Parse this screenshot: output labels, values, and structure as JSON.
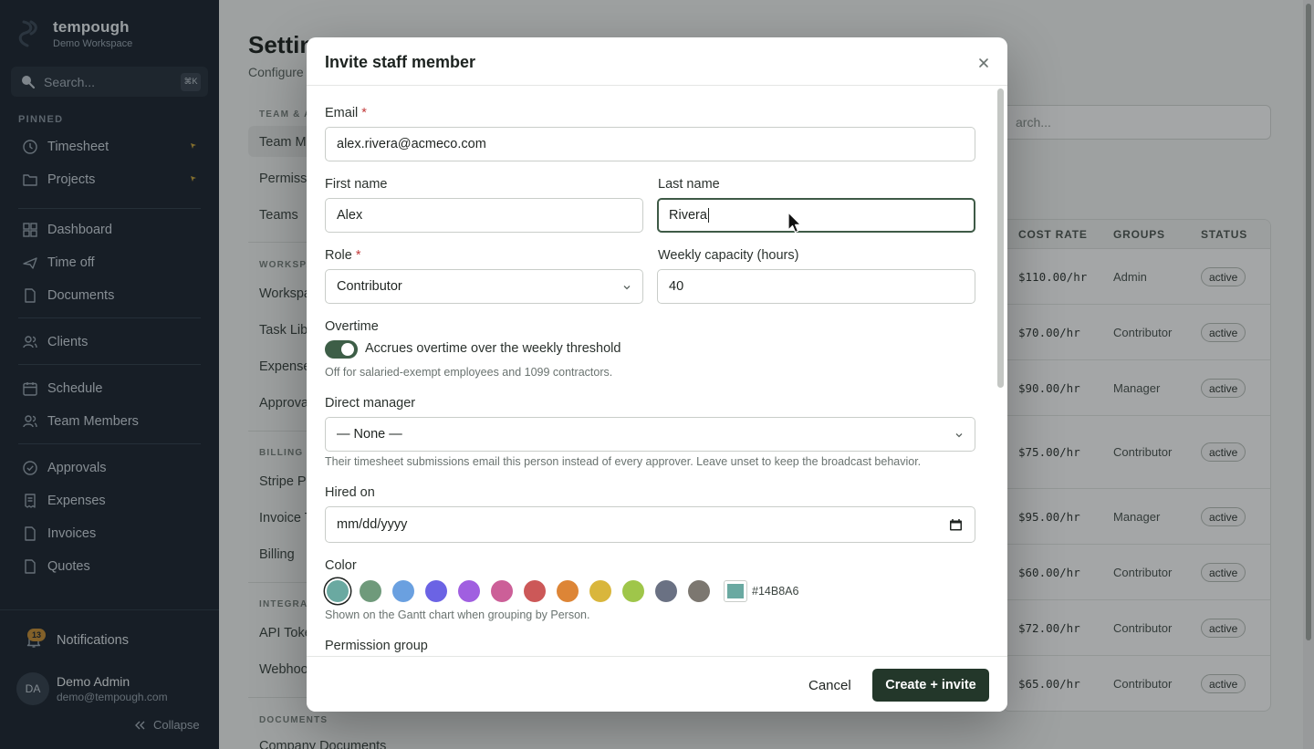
{
  "sidebar": {
    "brand_name": "tempough",
    "workspace": "Demo Workspace",
    "search_placeholder": "Search...",
    "search_shortcut": "⌘K",
    "pinned_label": "PINNED",
    "pinned": [
      {
        "label": "Timesheet",
        "icon": "clock-icon"
      },
      {
        "label": "Projects",
        "icon": "folder-icon"
      }
    ],
    "items": [
      {
        "label": "Dashboard",
        "icon": "grid-icon"
      },
      {
        "label": "Time off",
        "icon": "plane-icon"
      },
      {
        "label": "Documents",
        "icon": "file-icon"
      },
      {
        "label": "Clients",
        "icon": "users-icon"
      },
      {
        "label": "Schedule",
        "icon": "calendar-icon"
      },
      {
        "label": "Team Members",
        "icon": "users-icon"
      },
      {
        "label": "Approvals",
        "icon": "check-circle-icon"
      },
      {
        "label": "Expenses",
        "icon": "receipt-icon"
      },
      {
        "label": "Invoices",
        "icon": "file-icon"
      },
      {
        "label": "Quotes",
        "icon": "file-icon"
      }
    ],
    "notifications_label": "Notifications",
    "notifications_count": "13",
    "user_initials": "DA",
    "user_name": "Demo Admin",
    "user_email": "demo@tempough.com",
    "collapse_label": "Collapse"
  },
  "page": {
    "title": "Settin",
    "subtitle": "Configure",
    "settings_nav": {
      "section_team": "TEAM & A",
      "team_members": "Team M",
      "permissions": "Permiss",
      "teams": "Teams",
      "section_workspace": "WORKSPA",
      "workspace": "Workspa",
      "task_library": "Task Lib",
      "expenses": "Expense",
      "approvals": "Approva",
      "section_billing": "BILLING &",
      "stripe": "Stripe P",
      "invoice": "Invoice T",
      "billing": "Billing",
      "section_integrations": "INTEGRAT",
      "api_tokens": "API Toke",
      "webhooks": "Webhoo",
      "section_documents": "DOCUMENTS",
      "company_documents": "Company Documents"
    },
    "search_placeholder": "arch...",
    "table": {
      "headers": {
        "cost": "COST RATE",
        "groups": "GROUPS",
        "status": "STATUS"
      },
      "rows": [
        {
          "cost": "$110.00/hr",
          "group": "Admin",
          "status": "active"
        },
        {
          "cost": "$70.00/hr",
          "group": "Contributor",
          "status": "active"
        },
        {
          "cost": "$90.00/hr",
          "group": "Manager",
          "status": "active"
        },
        {
          "cost": "$75.00/hr",
          "group": "Contributor",
          "status": "active"
        },
        {
          "cost": "$95.00/hr",
          "group": "Manager",
          "status": "active"
        },
        {
          "cost": "$60.00/hr",
          "group": "Contributor",
          "status": "active"
        },
        {
          "cost": "$72.00/hr",
          "group": "Contributor",
          "status": "active"
        },
        {
          "cost": "$65.00/hr",
          "group": "Contributor",
          "status": "active"
        }
      ]
    }
  },
  "modal": {
    "title": "Invite staff member",
    "email_label": "Email",
    "email_value": "alex.rivera@acmeco.com",
    "first_name_label": "First name",
    "first_name_value": "Alex",
    "last_name_label": "Last name",
    "last_name_value": "Rivera",
    "role_label": "Role",
    "role_value": "Contributor",
    "capacity_label": "Weekly capacity (hours)",
    "capacity_value": "40",
    "overtime_label": "Overtime",
    "overtime_toggle_label": "Accrues overtime over the weekly threshold",
    "overtime_enabled": true,
    "overtime_help": "Off for salaried-exempt employees and 1099 contractors.",
    "manager_label": "Direct manager",
    "manager_value": "— None —",
    "manager_help": "Their timesheet submissions email this person instead of every approver. Leave unset to keep the broadcast behavior.",
    "hired_label": "Hired on",
    "hired_placeholder": "mm/dd/yyyy",
    "color_label": "Color",
    "colors": [
      "#6aa9a1",
      "#6f9a7b",
      "#6aa0e0",
      "#6b63e4",
      "#a05fe0",
      "#cc5f98",
      "#cc5858",
      "#dd8536",
      "#d9b63c",
      "#9fc64a",
      "#6a7183",
      "#7c7770"
    ],
    "selected_color": "#6aa9a1",
    "custom_color_hex": "#14B8A6",
    "color_help": "Shown on the Gantt chart when grouping by Person.",
    "permission_label": "Permission group",
    "cancel_label": "Cancel",
    "submit_label": "Create + invite"
  }
}
